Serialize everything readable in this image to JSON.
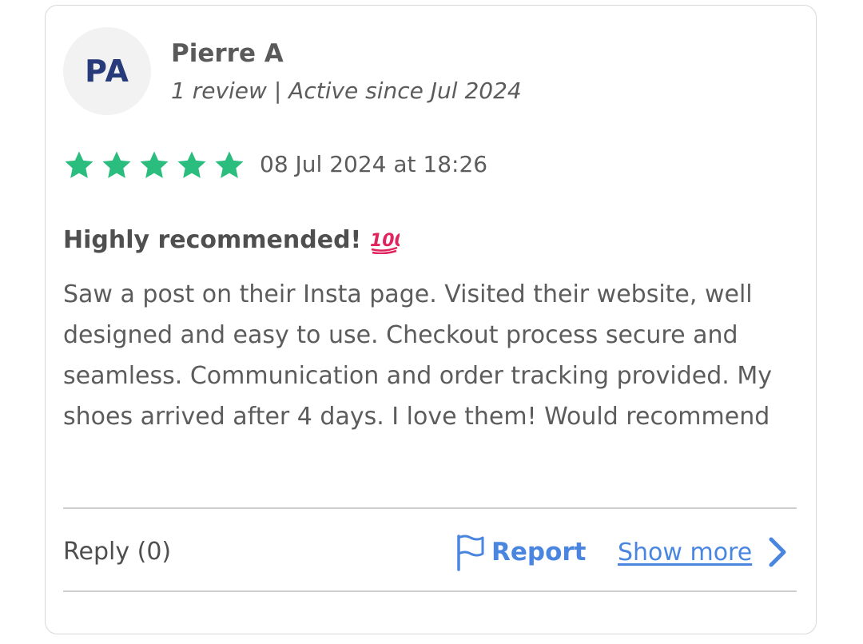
{
  "reviewer": {
    "initials": "PA",
    "name": "Pierre A",
    "meta": "1 review | Active since Jul 2024"
  },
  "rating": {
    "stars": 5,
    "max": 5,
    "color": "#2bbd7e"
  },
  "review": {
    "date": "08 Jul 2024 at 18:26",
    "title": "Highly recommended!",
    "title_icon": "hundred-points-icon",
    "body": "Saw a post on their Insta page. Visited their website, well designed and easy to use. Checkout process secure and seamless. Communication and order tracking provided. My shoes arrived after 4 days. I love them! Would recommend"
  },
  "actions": {
    "reply_label": "Reply (0)",
    "report_label": "Report",
    "show_more_label": "Show more",
    "link_color": "#4a86e0"
  }
}
